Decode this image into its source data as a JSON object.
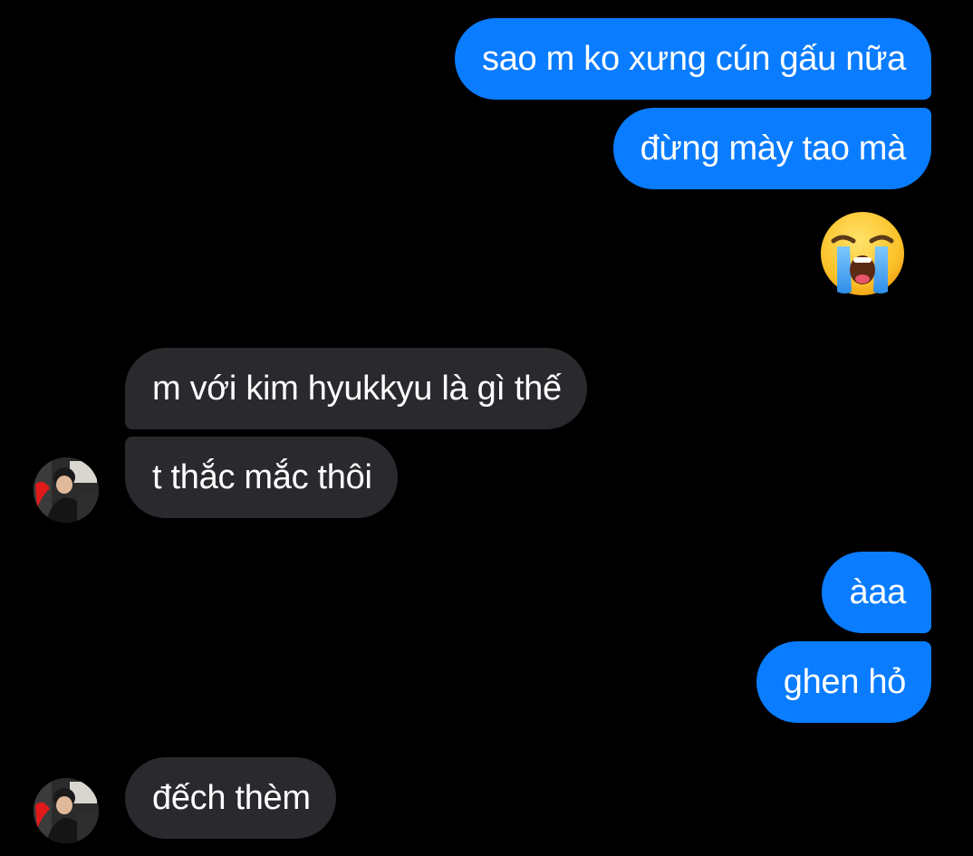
{
  "conversation": {
    "messages": [
      {
        "direction": "outgoing",
        "text": "sao m ko xưng cún gấu nữa"
      },
      {
        "direction": "outgoing",
        "text": "đừng mày tao mà"
      },
      {
        "direction": "outgoing",
        "type": "emoji",
        "emoji": "loudly-crying-face"
      },
      {
        "direction": "incoming",
        "text": "m với kim hyukkyu là gì thế"
      },
      {
        "direction": "incoming",
        "text": "t thắc mắc thôi"
      },
      {
        "direction": "outgoing",
        "text": "àaa"
      },
      {
        "direction": "outgoing",
        "text": "ghen hỏ"
      },
      {
        "direction": "incoming",
        "text": "đếch thèm"
      }
    ]
  },
  "colors": {
    "background": "#000000",
    "outgoing_bubble": "#0a7cff",
    "incoming_bubble": "#2a292e",
    "text": "#ffffff"
  }
}
